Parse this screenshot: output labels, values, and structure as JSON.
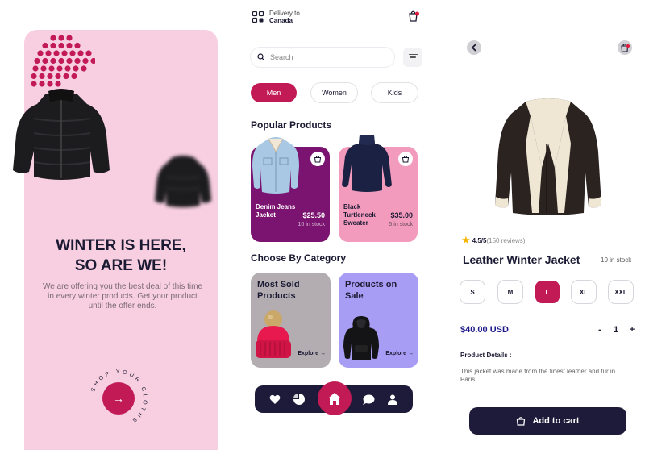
{
  "colors": {
    "accent": "#c21a55",
    "dark": "#1d1b39",
    "splash_bg": "#f8cfe0",
    "price_blue": "#1e1a8a"
  },
  "splash": {
    "title_line1": "WINTER IS HERE,",
    "title_line2": "SO ARE WE!",
    "description": "We are offering you the best deal of this time in every winter products. Get your product until the offer ends.",
    "circle_text": "SHOP YOUR CLOTHS",
    "arrow_icon": "arrow-right-icon"
  },
  "home": {
    "delivery_label": "Delivery to",
    "delivery_country": "Canada",
    "search_placeholder": "Search",
    "chips": [
      {
        "label": "Men",
        "active": true
      },
      {
        "label": "Women",
        "active": false
      },
      {
        "label": "Kids",
        "active": false
      }
    ],
    "popular_title": "Popular Products",
    "products": [
      {
        "name": "Denim Jeans Jacket",
        "price": "$25.50",
        "stock": "10 in stock",
        "color": "#7b1470"
      },
      {
        "name": "Black Turtleneck Sweater",
        "price": "$35.00",
        "stock": "5 in stock",
        "color": "#f29bbd"
      }
    ],
    "category_title": "Choose By Category",
    "categories": [
      {
        "title": "Most Sold Products",
        "explore": "Explore",
        "color": "#b3adb1"
      },
      {
        "title": "Products on Sale",
        "explore": "Explore",
        "color": "#a89df4"
      }
    ],
    "nav_icons": [
      "heart-icon",
      "chart-icon",
      "home-icon",
      "chat-icon",
      "profile-icon"
    ]
  },
  "detail": {
    "rating_score": "4.5/5",
    "rating_count": "(150 reviews)",
    "title": "Leather Winter Jacket",
    "stock": "10 in stock",
    "sizes": [
      "S",
      "M",
      "L",
      "XL",
      "XXL"
    ],
    "selected_size": "L",
    "price": "$40.00 USD",
    "quantity": "1",
    "qty_minus": "-",
    "qty_plus": "+",
    "details_label": "Product Details :",
    "details_text": "This jacket was made from the finest leather and fur in Paris.",
    "add_to_cart": "Add to cart"
  }
}
